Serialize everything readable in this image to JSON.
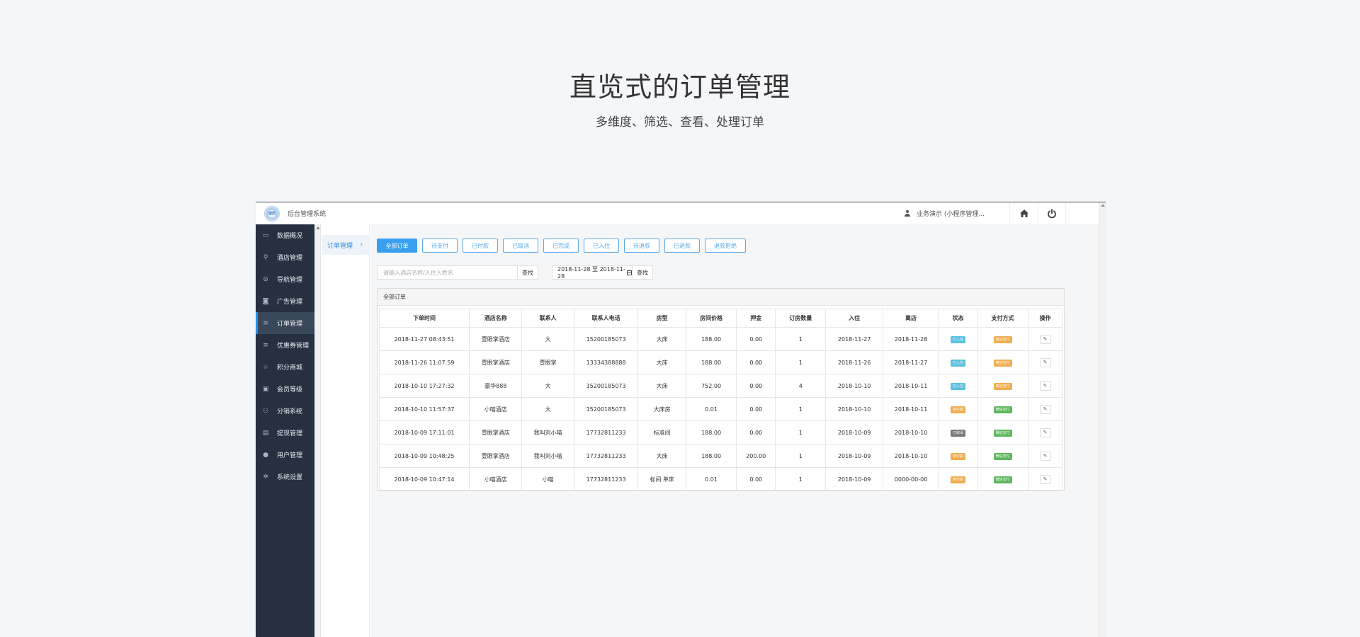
{
  "hero": {
    "title": "直览式的订单管理",
    "subtitle": "多维度、筛选、查看、处理订单"
  },
  "topbar": {
    "logo_text": "逆风",
    "system_title": "后台管理系统",
    "user_label": "业务演示 (小程序管理...",
    "home_icon": "home-icon",
    "power_icon": "power-icon"
  },
  "sidebar": {
    "items": [
      {
        "label": "数据概况",
        "icon": "dashboard-icon"
      },
      {
        "label": "酒店管理",
        "icon": "cart-icon"
      },
      {
        "label": "导航管理",
        "icon": "compass-icon"
      },
      {
        "label": "广告管理",
        "icon": "camera-icon"
      },
      {
        "label": "订单管理",
        "icon": "list-icon",
        "active": true
      },
      {
        "label": "优惠券管理",
        "icon": "list-icon"
      },
      {
        "label": "积分商城",
        "icon": "star-icon"
      },
      {
        "label": "会员等级",
        "icon": "card-icon"
      },
      {
        "label": "分销系统",
        "icon": "users-icon"
      },
      {
        "label": "提现管理",
        "icon": "wallet-icon"
      },
      {
        "label": "用户管理",
        "icon": "user-icon"
      },
      {
        "label": "系统设置",
        "icon": "gear-icon"
      }
    ]
  },
  "subnav": {
    "label": "订单管理"
  },
  "filters": [
    "全部订单",
    "待支付",
    "已付款",
    "已取消",
    "已完成",
    "已入住",
    "待退款",
    "已退款",
    "退款拒绝"
  ],
  "search": {
    "placeholder": "请输入酒店名称/入住人姓名",
    "button": "查找"
  },
  "date_range": {
    "value": "2018-11-28 至 2018-11-28",
    "button": "查找"
  },
  "panel": {
    "title": "全部订单"
  },
  "table": {
    "columns": [
      "下单时间",
      "酒店名称",
      "联系人",
      "联系人电话",
      "房型",
      "房间价格",
      "押金",
      "订房数量",
      "入住",
      "离店",
      "状态",
      "支付方式",
      "操作"
    ],
    "rows": [
      [
        "2018-11-27 08:43:51",
        "壹眼掌酒店",
        "大",
        "15200185073",
        "大床",
        "188.00",
        "0.00",
        "1",
        "2018-11-27",
        "2018-11-28",
        "已入住",
        "到店支付"
      ],
      [
        "2018-11-26 11:07:59",
        "壹眼掌酒店",
        "壹眼掌",
        "13334388888",
        "大床",
        "188.00",
        "0.00",
        "1",
        "2018-11-26",
        "2018-11-27",
        "已入住",
        "到店支付"
      ],
      [
        "2018-10-10 17:27:32",
        "豪华888",
        "大",
        "15200185073",
        "大床",
        "752.00",
        "0.00",
        "4",
        "2018-10-10",
        "2018-10-11",
        "已入住",
        "到店支付"
      ],
      [
        "2018-10-10 11:57:37",
        "小喵酒店",
        "大",
        "15200185073",
        "大床房",
        "0.01",
        "0.00",
        "1",
        "2018-10-10",
        "2018-10-11",
        "待付款",
        "微信支付"
      ],
      [
        "2018-10-09 17:11:01",
        "壹眼掌酒店",
        "我叫刘小喵",
        "17732811233",
        "标准间",
        "188.00",
        "0.00",
        "1",
        "2018-10-09",
        "2018-10-10",
        "已取消",
        "微信支付"
      ],
      [
        "2018-10-09 10:48:25",
        "壹眼掌酒店",
        "我叫刘小喵",
        "17732811233",
        "大床",
        "188.00",
        "200.00",
        "1",
        "2018-10-09",
        "2018-10-10",
        "待付款",
        "微信支付"
      ],
      [
        "2018-10-09 10:47:14",
        "小喵酒店",
        "小喵",
        "17732811233",
        "标间 单床",
        "0.01",
        "0.00",
        "1",
        "2018-10-09",
        "0000-00-00",
        "待付款",
        "微信支付"
      ]
    ],
    "status_colors": {
      "已入住": "#5bc0de",
      "待付款": "#f0ad4e",
      "已取消": "#777777"
    },
    "pay_colors": {
      "到店支付": "#f0ad4e",
      "微信支付": "#5cb85c"
    }
  },
  "colors": {
    "sidebar_bg": "#253040",
    "accent": "#39a0f0"
  }
}
